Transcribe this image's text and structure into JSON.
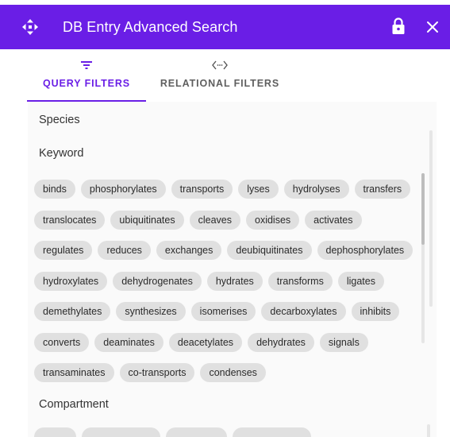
{
  "window": {
    "title": "DB Entry Advanced Search",
    "accent_color": "#6a1ee6",
    "icons": {
      "drag": "move-arrows-icon",
      "lock": "lock-icon",
      "close": "close-icon"
    }
  },
  "tabs": [
    {
      "label": "QUERY FILTERS",
      "icon": "filter-icon",
      "active": true
    },
    {
      "label": "RELATIONAL FILTERS",
      "icon": "code-brackets-icon",
      "active": false
    }
  ],
  "filters": {
    "species": {
      "label": "Species"
    },
    "keyword": {
      "label": "Keyword",
      "chips": [
        "binds",
        "phosphorylates",
        "transports",
        "lyses",
        "hydrolyses",
        "transfers",
        "translocates",
        "ubiquitinates",
        "cleaves",
        "oxidises",
        "activates",
        "regulates",
        "reduces",
        "exchanges",
        "deubiquitinates",
        "dephosphorylates",
        "hydroxylates",
        "dehydrogenates",
        "hydrates",
        "transforms",
        "ligates",
        "demethylates",
        "synthesizes",
        "isomerises",
        "decarboxylates",
        "inhibits",
        "converts",
        "deaminates",
        "deacetylates",
        "dehydrates",
        "signals",
        "transaminates",
        "co-transports",
        "condenses"
      ]
    },
    "compartment": {
      "label": "Compartment"
    }
  }
}
